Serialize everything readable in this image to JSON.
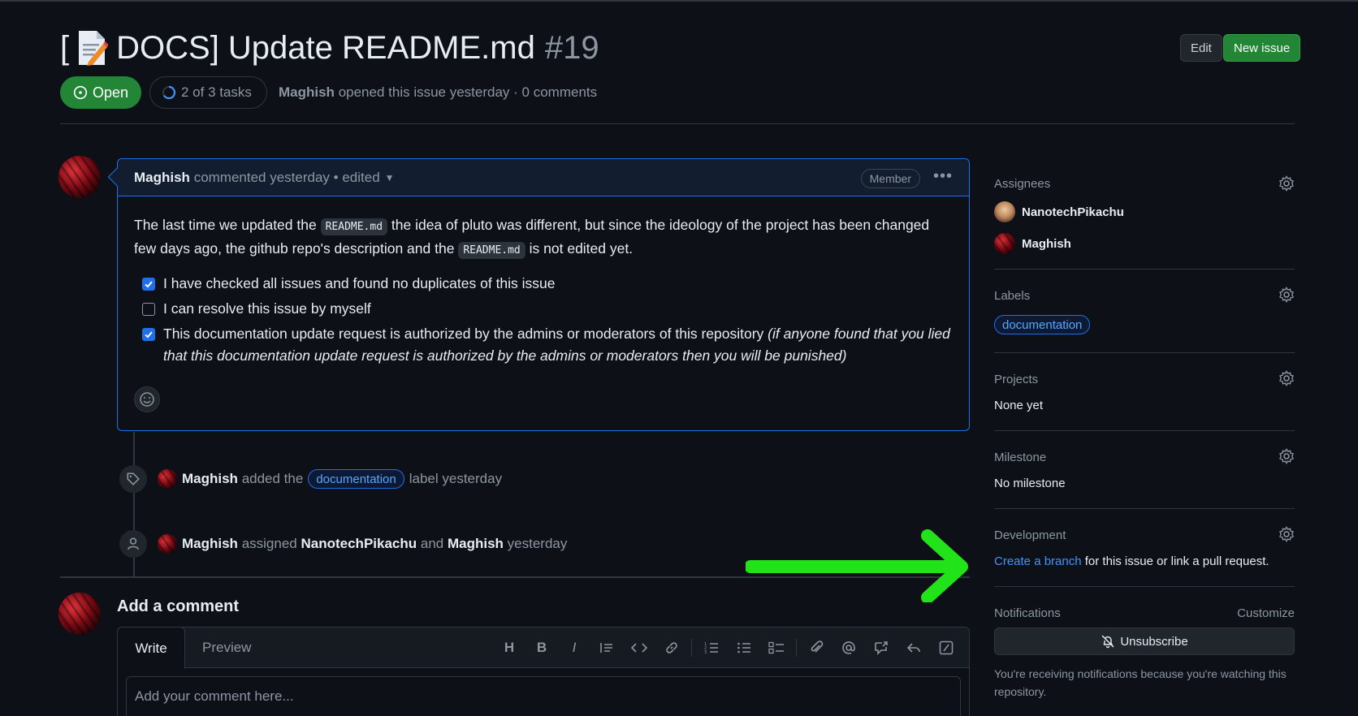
{
  "issue": {
    "title_prefix": "[",
    "title_text": "DOCS] Update README.md",
    "number": "#19",
    "state": "Open",
    "tasks": "2 of 3 tasks",
    "author": "Maghish",
    "meta_text": "opened this issue yesterday · 0 comments"
  },
  "header_buttons": {
    "edit": "Edit",
    "new_issue": "New issue"
  },
  "comment": {
    "author": "Maghish",
    "meta": "commented yesterday • edited",
    "role_badge": "Member",
    "body_p1": "The last time we updated the",
    "code1": "README.md",
    "body_p2": "the idea of pluto was different, but since the ideology of the project has been changed few days ago, the github repo's description and the",
    "code2": "README.md",
    "body_p3": "is not edited yet.",
    "tasks": [
      {
        "checked": true,
        "text": "I have checked all issues and found no duplicates of this issue"
      },
      {
        "checked": false,
        "text": "I can resolve this issue by myself"
      },
      {
        "checked": true,
        "text": "This documentation update request is authorized by the admins or moderators of this repository",
        "emphasis": "(if anyone found that you lied that this documentation update request is authorized by the admins or moderators then you will be punished)"
      }
    ]
  },
  "timeline": {
    "event1": {
      "actor": "Maghish",
      "pre": "added the",
      "label": "documentation",
      "post": "label yesterday"
    },
    "event2": {
      "actor": "Maghish",
      "pre": "assigned",
      "user1": "NanotechPikachu",
      "mid": "and",
      "user2": "Maghish",
      "post": "yesterday"
    }
  },
  "add_comment": {
    "title": "Add a comment",
    "tab_write": "Write",
    "tab_preview": "Preview",
    "placeholder": "Add your comment here..."
  },
  "sidebar": {
    "assignees_title": "Assignees",
    "assignees": [
      "NanotechPikachu",
      "Maghish"
    ],
    "labels_title": "Labels",
    "label": "documentation",
    "projects_title": "Projects",
    "projects_value": "None yet",
    "milestone_title": "Milestone",
    "milestone_value": "No milestone",
    "development_title": "Development",
    "development_link": "Create a branch",
    "development_text": "for this issue or link a pull request.",
    "notifications_title": "Notifications",
    "customize": "Customize",
    "unsubscribe": "Unsubscribe",
    "notifications_note": "You're receiving notifications because you're watching this repository."
  },
  "colors": {
    "accent_blue": "#1f6feb",
    "open_green": "#238636",
    "annotation_arrow": "#22e31a"
  }
}
